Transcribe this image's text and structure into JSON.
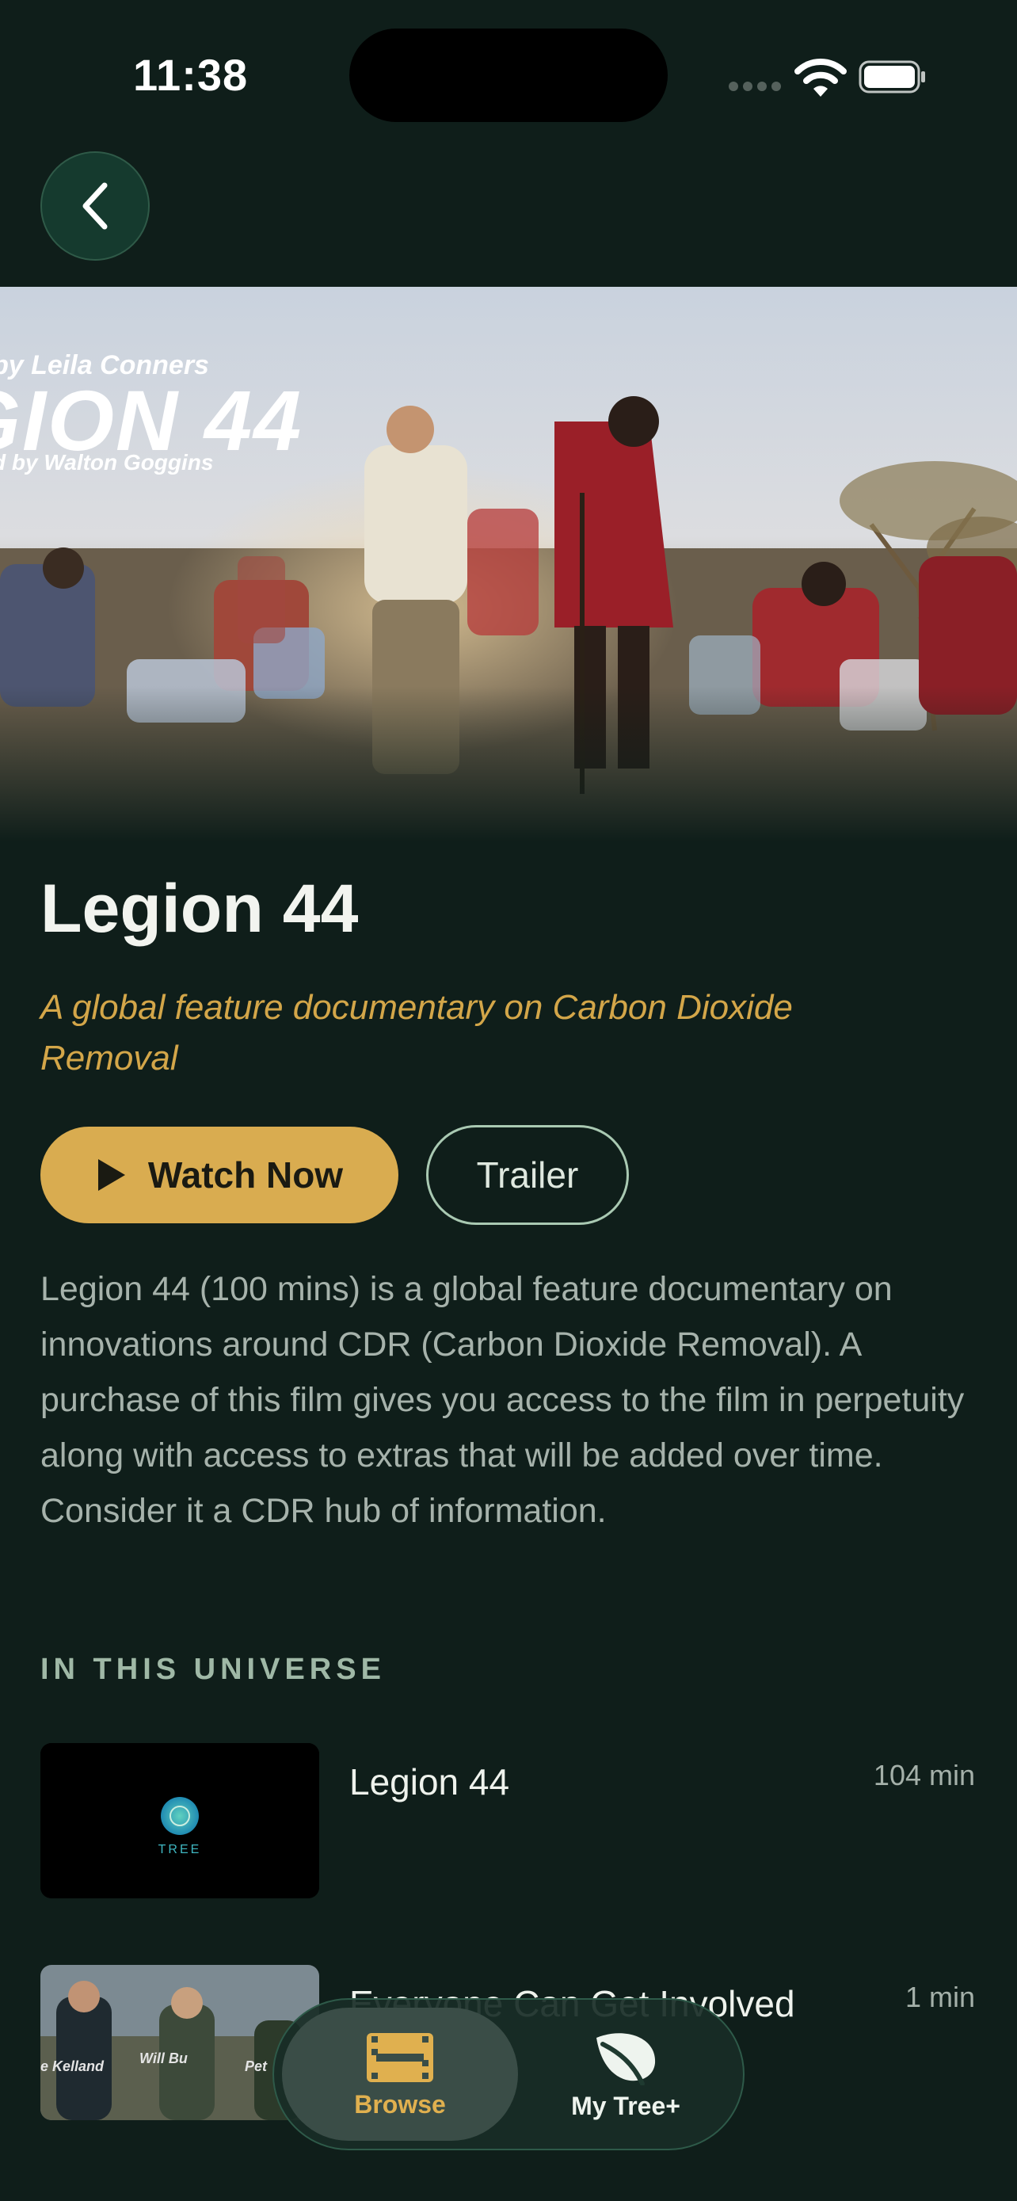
{
  "status_bar": {
    "time": "11:38",
    "icons": [
      "signal-icon",
      "wifi-icon",
      "battery-icon"
    ]
  },
  "nav": {
    "back_icon": "chevron-left-icon"
  },
  "hero": {
    "credit_line_1": "by Leila Conners",
    "logo_text": "GION 44",
    "credit_line_2": "d by Walton Goggins"
  },
  "film": {
    "title": "Legion 44",
    "tagline": "A global feature documentary on Carbon Dioxide Removal",
    "watch_label": "Watch Now",
    "trailer_label": "Trailer",
    "description": "Legion 44 (100 mins) is a global feature documentary on innovations around CDR (Carbon Dioxide Removal). A purchase of this film gives you access to the film in perpetuity along with access to extras that will be added over time. Consider it a CDR hub of information."
  },
  "universe": {
    "heading": "IN THIS UNIVERSE",
    "items": [
      {
        "title": "Legion 44",
        "duration": "104 min",
        "thumb_text": "TREE"
      },
      {
        "title": "Everyone Can Get Involved",
        "duration": "1 min",
        "thumb_text_1": "e Kelland",
        "thumb_text_2": "Will Bu",
        "thumb_text_3": "Pet"
      }
    ]
  },
  "tabbar": {
    "tabs": [
      {
        "label": "Browse",
        "icon": "film-icon",
        "active": true
      },
      {
        "label": "My Tree+",
        "icon": "leaf-icon",
        "active": false
      }
    ]
  },
  "colors": {
    "background": "#0f1e1a",
    "accent_gold": "#d9ac50",
    "tagline_gold": "#d3a649",
    "trailer_border": "#a9c9b2"
  }
}
